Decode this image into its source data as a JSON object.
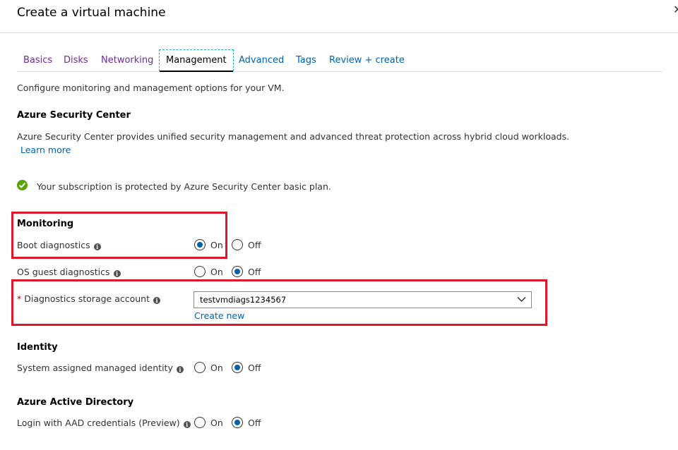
{
  "header": {
    "title": "Create a virtual machine",
    "close": "✕"
  },
  "tabs": [
    {
      "label": "Basics"
    },
    {
      "label": "Disks"
    },
    {
      "label": "Networking"
    },
    {
      "label": "Management"
    },
    {
      "label": "Advanced"
    },
    {
      "label": "Tags"
    },
    {
      "label": "Review + create"
    }
  ],
  "colors": {
    "visited_tab": "#6a2c91",
    "link": "#0062ad",
    "success": "#57a300",
    "highlight": "#e0162b"
  },
  "intro": "Configure monitoring and management options for your VM.",
  "security_center": {
    "heading": "Azure Security Center",
    "description": "Azure Security Center provides unified security management and advanced threat protection across hybrid cloud workloads.",
    "learn_more": "Learn more",
    "status": "Your subscription is protected by Azure Security Center basic plan.",
    "status_icon": "success-check-icon"
  },
  "monitoring": {
    "heading": "Monitoring",
    "boot_diagnostics": {
      "label": "Boot diagnostics",
      "on": "On",
      "off": "Off",
      "selected": "On"
    },
    "os_guest_diagnostics": {
      "label": "OS guest diagnostics",
      "on": "On",
      "off": "Off",
      "selected": "Off"
    },
    "storage_account": {
      "required_mark": "*",
      "label": "Diagnostics storage account",
      "value": "testvmdiags1234567",
      "create_new": "Create new"
    }
  },
  "identity": {
    "heading": "Identity",
    "managed_identity": {
      "label": "System assigned managed identity",
      "on": "On",
      "off": "Off",
      "selected": "Off"
    }
  },
  "aad": {
    "heading": "Azure Active Directory",
    "login": {
      "label": "Login with AAD credentials (Preview)",
      "on": "On",
      "off": "Off",
      "selected": "Off"
    }
  }
}
